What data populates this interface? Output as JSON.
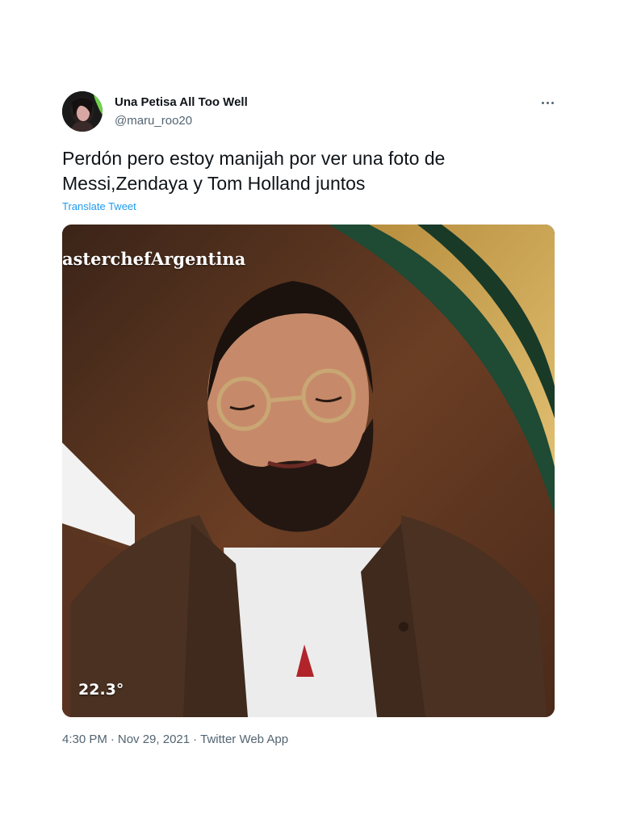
{
  "author": {
    "name": "Una Petisa All Too Well",
    "handle": "@maru_roo20",
    "avatar_icon": "profile-photo"
  },
  "menu": {
    "more_icon": "more-horizontal-icon"
  },
  "tweet": {
    "text_lines": [
      "Perdón pero estoy manijah por ver una foto de",
      "Messi,Zendaya y Tom Holland juntos"
    ],
    "translate_label": "Translate Tweet"
  },
  "media": {
    "watermark": "asterchefArgentina",
    "temperature": "22.3°"
  },
  "meta": {
    "time": "4:30 PM",
    "date": "Nov 29, 2021",
    "separator": "·",
    "source": "Twitter Web App"
  },
  "colors": {
    "link": "#1d9bf0",
    "secondary_text": "#536471",
    "primary_text": "#0f1419"
  }
}
